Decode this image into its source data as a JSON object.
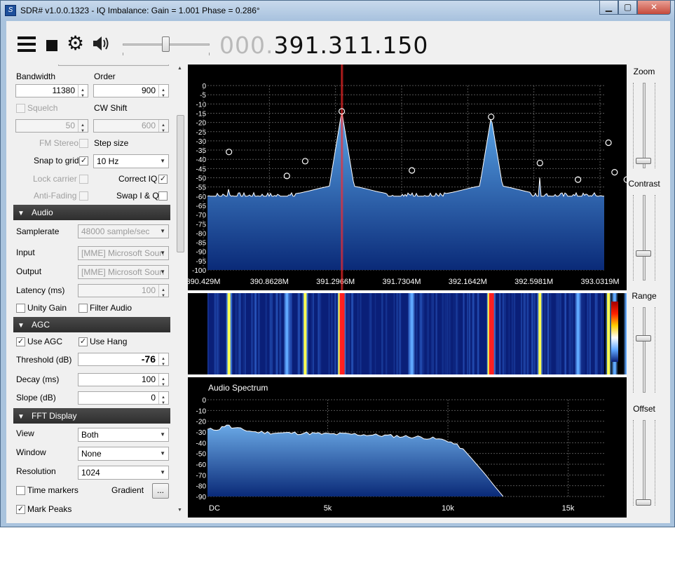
{
  "window": {
    "title": "SDR# v1.0.0.1323 - IQ Imbalance: Gain = 1.001 Phase = 0.286°",
    "app_icon": "sdrsharp-logo-icon",
    "min_glyph": "▁",
    "max_glyph": "▢",
    "close_glyph": "✕"
  },
  "toolbar": {
    "menu_icon": "hamburger-menu-icon",
    "stop_icon": "stop-icon",
    "settings_icon": "gear-icon",
    "settings_glyph": "⚙",
    "audio_icon": "speaker-icon",
    "audio_glyph": "🔊",
    "volume_level": 0.5,
    "frequency_dim": "000.",
    "frequency_main": "391.311.150"
  },
  "radio": {
    "bandwidth_label": "Bandwidth",
    "bandwidth_value": "11380",
    "order_label": "Order",
    "order_value": "900",
    "squelch_label": "Squelch",
    "squelch_value": "50",
    "cw_shift_label": "CW Shift",
    "cw_shift_value": "600",
    "fm_stereo_label": "FM Stereo",
    "step_size_label": "Step size",
    "snap_label": "Snap to grid",
    "snap_checked": "✓",
    "step_value": "10 Hz",
    "lock_carrier_label": "Lock carrier",
    "correct_iq_label": "Correct IQ",
    "correct_iq_checked": "✓",
    "anti_fading_label": "Anti-Fading",
    "swap_iq_label": "Swap I & Q"
  },
  "audio_section": {
    "header": "Audio",
    "samplerate_label": "Samplerate",
    "samplerate_value": "48000 sample/sec",
    "input_label": "Input",
    "input_value": "[MME] Microsoft Soun",
    "output_label": "Output",
    "output_value": "[MME] Microsoft Soun",
    "latency_label": "Latency (ms)",
    "latency_value": "100",
    "unity_gain_label": "Unity Gain",
    "filter_audio_label": "Filter Audio"
  },
  "agc": {
    "header": "AGC",
    "use_agc_label": "Use AGC",
    "use_agc_checked": "✓",
    "use_hang_label": "Use Hang",
    "use_hang_checked": "✓",
    "threshold_label": "Threshold (dB)",
    "threshold_value": "-76",
    "decay_label": "Decay (ms)",
    "decay_value": "100",
    "slope_label": "Slope (dB)",
    "slope_value": "0"
  },
  "fft_display": {
    "header": "FFT Display",
    "view_label": "View",
    "view_value": "Both",
    "window_label": "Window",
    "window_value": "None",
    "resolution_label": "Resolution",
    "resolution_value": "1024",
    "time_markers_label": "Time markers",
    "gradient_label": "Gradient",
    "gradient_button": "...",
    "mark_peaks_label": "Mark Peaks",
    "mark_peaks_checked": "✓"
  },
  "right_sliders": {
    "zoom_label": "Zoom",
    "zoom_level": 0.05,
    "contrast_label": "Contrast",
    "contrast_level": 0.3,
    "range_label": "Range",
    "range_level": 0.65,
    "offset_label": "Offset",
    "offset_level": 0.0
  },
  "chart_data": [
    {
      "type": "area",
      "name": "rf-spectrum",
      "title": "",
      "ylim": [
        -100,
        0
      ],
      "yticks": [
        "0",
        "-5",
        "-10",
        "-15",
        "-20",
        "-25",
        "-30",
        "-35",
        "-40",
        "-45",
        "-50",
        "-55",
        "-60",
        "-65",
        "-70",
        "-75",
        "-80",
        "-85",
        "-90",
        "-95",
        "-100"
      ],
      "xticks": [
        "390.429M",
        "390.8628M",
        "391.2966M",
        "391.7304M",
        "392.1642M",
        "392.5981M",
        "393.0319M"
      ],
      "x_range_mhz": [
        390.429,
        393.0319
      ],
      "noise_floor_db": -60,
      "tuned_mhz": 391.3112,
      "peaks": [
        {
          "x": 390.57,
          "db": -36
        },
        {
          "x": 390.95,
          "db": -49
        },
        {
          "x": 391.07,
          "db": -41
        },
        {
          "x": 391.31,
          "db": -14
        },
        {
          "x": 391.77,
          "db": -46
        },
        {
          "x": 392.29,
          "db": -17
        },
        {
          "x": 392.61,
          "db": -42
        },
        {
          "x": 392.86,
          "db": -51
        },
        {
          "x": 393.06,
          "db": -31
        },
        {
          "x": 393.1,
          "db": -47
        },
        {
          "x": 393.18,
          "db": -51
        }
      ],
      "colors": {
        "fill_top": "#5aa6e8",
        "fill_bottom": "#0a2a78",
        "trace": "#ffffff",
        "grid": "#555555",
        "marker": "#ffffff",
        "cursor": "#ff2a2a"
      }
    },
    {
      "type": "heatmap",
      "name": "waterfall",
      "lines": [
        {
          "x": 390.57,
          "strength": 0.75
        },
        {
          "x": 390.95,
          "strength": 0.6
        },
        {
          "x": 391.07,
          "strength": 0.7
        },
        {
          "x": 391.31,
          "strength": 1.0
        },
        {
          "x": 391.77,
          "strength": 0.6
        },
        {
          "x": 392.29,
          "strength": 1.0
        },
        {
          "x": 392.61,
          "strength": 0.7
        },
        {
          "x": 392.86,
          "strength": 0.55
        },
        {
          "x": 393.06,
          "strength": 0.8
        },
        {
          "x": 393.1,
          "strength": 0.6
        },
        {
          "x": 393.18,
          "strength": 0.55
        }
      ],
      "colors": {
        "bg": "#0a1f78",
        "weak": "#5fa8ff",
        "strong": "#ffff50",
        "peak": "#ff2020"
      }
    },
    {
      "type": "area",
      "name": "audio-spectrum",
      "title": "Audio Spectrum",
      "ylim": [
        -90,
        0
      ],
      "yticks": [
        "0",
        "-10",
        "-20",
        "-30",
        "-40",
        "-50",
        "-60",
        "-70",
        "-80",
        "-90"
      ],
      "xticks": [
        "DC",
        "5k",
        "10k",
        "15k"
      ],
      "x_range_hz": [
        0,
        16500
      ],
      "points": [
        [
          0,
          -28
        ],
        [
          500,
          -27
        ],
        [
          800,
          -23
        ],
        [
          1000,
          -26
        ],
        [
          2000,
          -30
        ],
        [
          3000,
          -31
        ],
        [
          4000,
          -31
        ],
        [
          5000,
          -32
        ],
        [
          6000,
          -32
        ],
        [
          7000,
          -33
        ],
        [
          8000,
          -34
        ],
        [
          9000,
          -35
        ],
        [
          10000,
          -38
        ],
        [
          10500,
          -44
        ],
        [
          11000,
          -55
        ],
        [
          11500,
          -68
        ],
        [
          12000,
          -82
        ],
        [
          12300,
          -90
        ]
      ],
      "colors": {
        "fill_top": "#6aa9e6",
        "fill_bottom": "#0a2a78",
        "trace": "#ffffff",
        "grid": "#555555"
      }
    }
  ]
}
